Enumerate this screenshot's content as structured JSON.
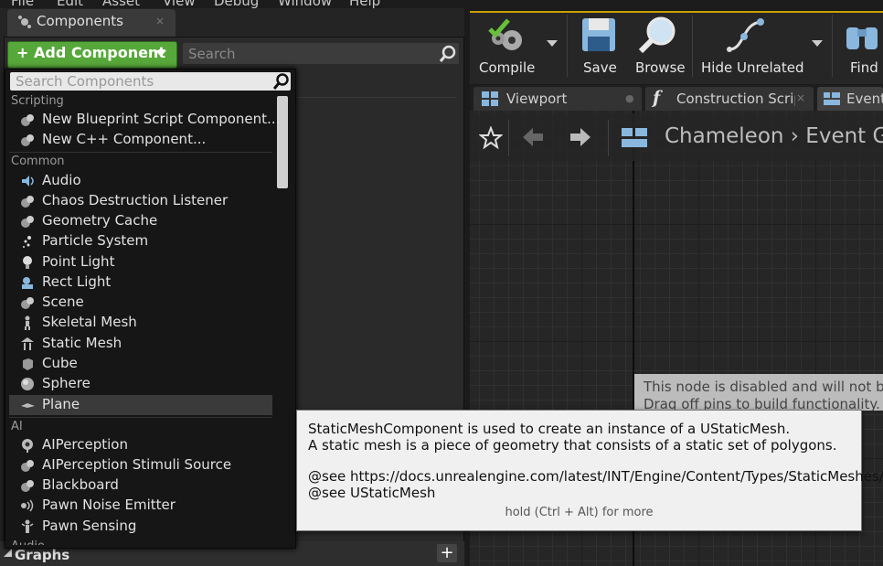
{
  "menubar": [
    "File",
    "Edit",
    "Asset",
    "View",
    "Debug",
    "Window",
    "Help"
  ],
  "left_panel": {
    "tab_label": "Components",
    "tab_close": "×",
    "add_button": "+ Add Component",
    "search_placeholder": "Search"
  },
  "dropdown": {
    "search_placeholder": "Search Components",
    "sections": {
      "scripting": "Scripting",
      "common": "Common",
      "ai": "AI",
      "audio": "Audio"
    },
    "items": {
      "new_blueprint_script": "New Blueprint Script Component...",
      "new_cpp": "New C++ Component...",
      "audio": "Audio",
      "chaos": "Chaos Destruction Listener",
      "geometry_cache": "Geometry Cache",
      "particle_system": "Particle System",
      "point_light": "Point Light",
      "rect_light": "Rect Light",
      "scene": "Scene",
      "skeletal_mesh": "Skeletal Mesh",
      "static_mesh": "Static Mesh",
      "cube": "Cube",
      "sphere": "Sphere",
      "plane": "Plane",
      "ai_perception": "AIPerception",
      "ai_stimuli": "AIPerception Stimuli Source",
      "blackboard": "Blackboard",
      "pawn_noise": "Pawn Noise Emitter",
      "pawn_sensing": "Pawn Sensing"
    }
  },
  "tooltip": {
    "line1": "StaticMeshComponent is used to create an instance of a UStaticMesh.",
    "line2": "A static mesh is a piece of geometry that consists of a static set of polygons.",
    "line3": "@see https://docs.unrealengine.com/latest/INT/Engine/Content/Types/StaticMeshes/",
    "line4": "@see UStaticMesh",
    "hint": "hold (Ctrl + Alt) for more"
  },
  "toolbar": {
    "compile": "Compile",
    "save": "Save",
    "browse": "Browse",
    "hide_unrelated": "Hide Unrelated",
    "find": "Find"
  },
  "editor_tabs": {
    "viewport": "Viewport",
    "construction": "Construction Scrip",
    "event": "Event"
  },
  "graph": {
    "breadcrumb": "Chameleon › Event Gr",
    "disabled_line1": "This node is disabled and will not be",
    "disabled_line2": "Drag off pins to build functionality."
  },
  "footer": {
    "graphs_label": "Graphs",
    "plus": "+"
  },
  "colors": {
    "add_button": "#57a83a",
    "toolbar_accent": "#c8a000",
    "selection": "#3a3a3a"
  }
}
